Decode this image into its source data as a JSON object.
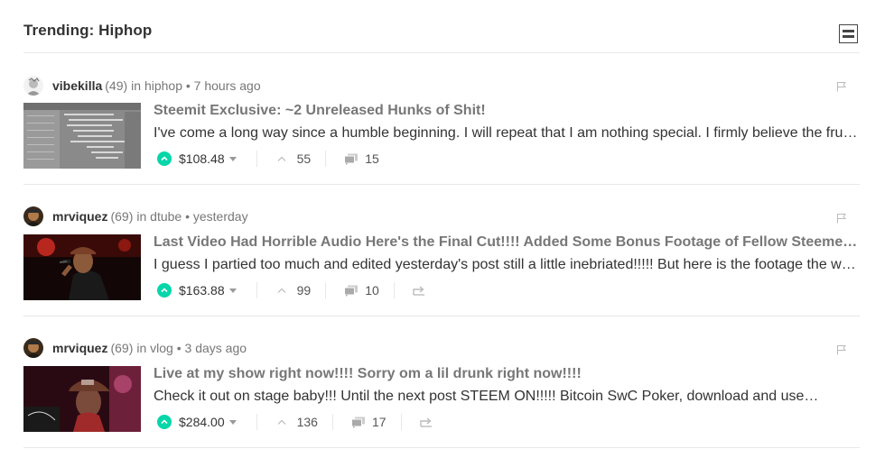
{
  "header": {
    "title": "Trending: Hiphop"
  },
  "posts": [
    {
      "author": "vibekilla",
      "reputation": "(49)",
      "meta": "in hiphop • 7 hours ago",
      "title": "Steemit Exclusive: ~2 Unreleased Hunks of Shit!",
      "body": "I've come a long way since a humble beginning. I will repeat that I am nothing special. I firmly believe the fruits of my labor will come someday if I keep working hard.",
      "payout": "$108.48",
      "votes": "55",
      "comments": "15",
      "resteem": false
    },
    {
      "author": "mrviquez",
      "reputation": "(69)",
      "meta": "in dtube • yesterday",
      "title": "Last Video Had Horrible Audio Here's the Final Cut!!!! Added Some Bonus Footage of Fellow Steemers!!!",
      "body": "I guess I partied too much and edited yesterday's post still a little inebriated!!!!! But here is the footage the way it was supposed to be.",
      "payout": "$163.88",
      "votes": "99",
      "comments": "10",
      "resteem": true
    },
    {
      "author": "mrviquez",
      "reputation": "(69)",
      "meta": "in vlog • 3 days ago",
      "title": "Live at my show right now!!!! Sorry om a lil drunk right now!!!!",
      "body": "Check it out on stage baby!!! Until the next post STEEM ON!!!!! Bitcoin SwC Poker, download and use…",
      "payout": "$284.00",
      "votes": "136",
      "comments": "17",
      "resteem": true
    }
  ],
  "colors": {
    "upvote": "#06d6a9",
    "title": "#777777",
    "divider": "#e8e8e8"
  },
  "icons": [
    "layout-toggle-icon",
    "flag-icon",
    "upvote-icon",
    "chevron-up-icon",
    "comment-icon",
    "resteem-icon"
  ]
}
